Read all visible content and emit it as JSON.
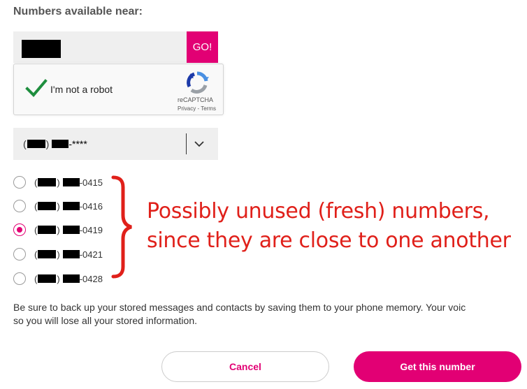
{
  "heading": "Numbers available near:",
  "zip_search": {
    "value": "",
    "go_label": "GO!"
  },
  "captcha": {
    "label": "I'm not a robot",
    "brand": "reCAPTCHA",
    "links": "Privacy - Terms"
  },
  "prefix_select": {
    "suffix": "-****"
  },
  "numbers": [
    {
      "suffix": "-0415",
      "selected": false
    },
    {
      "suffix": "-0416",
      "selected": false
    },
    {
      "suffix": "-0419",
      "selected": true
    },
    {
      "suffix": "-0421",
      "selected": false
    },
    {
      "suffix": "-0428",
      "selected": false
    }
  ],
  "annotation": {
    "line1": "Possibly unused (fresh) numbers,",
    "line2": "since they are close to one another"
  },
  "notice": {
    "line1": "Be sure to back up your stored messages and contacts by saving them to your phone memory. Your voic",
    "line2": "so you will lose all your stored information."
  },
  "actions": {
    "cancel_label": "Cancel",
    "get_label": "Get this number"
  },
  "colors": {
    "brand": "#e20074",
    "annotation": "#e0201a"
  }
}
